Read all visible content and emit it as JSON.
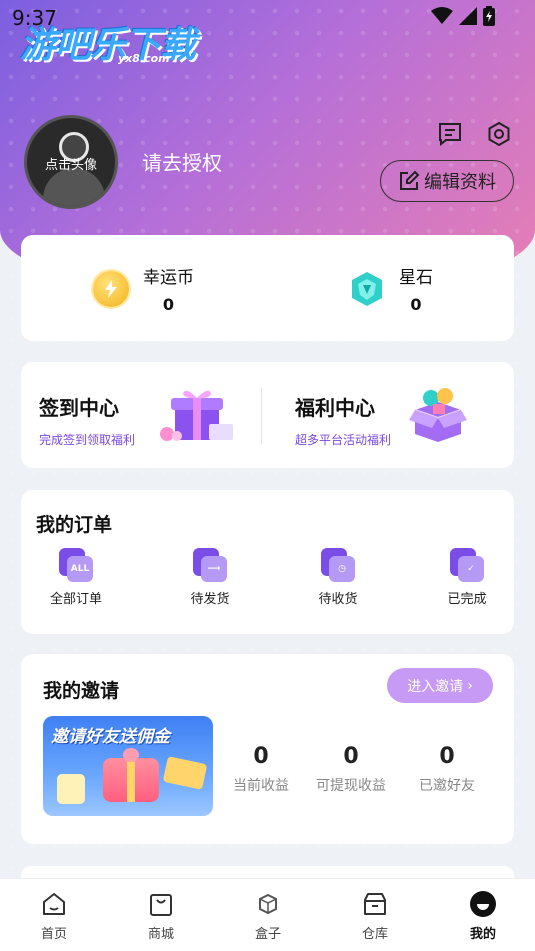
{
  "status": {
    "time": "9:37"
  },
  "watermark": {
    "text": "游吧乐下载",
    "url": "yx8.com"
  },
  "profile": {
    "avatar_label": "点击头像",
    "username": "请去授权",
    "edit_label": "编辑资料"
  },
  "currencies": [
    {
      "name": "幸运币",
      "value": "0",
      "icon": "lightning-coin-icon"
    },
    {
      "name": "星石",
      "value": "0",
      "icon": "star-stone-icon"
    }
  ],
  "centers": [
    {
      "title": "签到中心",
      "subtitle": "完成签到领取福利",
      "icon": "gift-box-icon"
    },
    {
      "title": "福利中心",
      "subtitle": "超多平台活动福利",
      "icon": "welfare-box-icon"
    }
  ],
  "orders": {
    "title": "我的订单",
    "items": [
      {
        "label": "全部订单",
        "badge": "ALL"
      },
      {
        "label": "待发货",
        "badge": ""
      },
      {
        "label": "待收货",
        "badge": ""
      },
      {
        "label": "已完成",
        "badge": ""
      }
    ]
  },
  "invite": {
    "title": "我的邀请",
    "button": "进入邀请",
    "banner_text": "邀请好友送佣金",
    "stats": [
      {
        "value": "0",
        "label": "当前收益"
      },
      {
        "value": "0",
        "label": "可提现收益"
      },
      {
        "value": "0",
        "label": "已邀好友"
      }
    ]
  },
  "tabs": [
    {
      "label": "首页",
      "icon": "home-icon"
    },
    {
      "label": "商城",
      "icon": "shop-bag-icon"
    },
    {
      "label": "盒子",
      "icon": "box-icon"
    },
    {
      "label": "仓库",
      "icon": "warehouse-icon"
    },
    {
      "label": "我的",
      "icon": "profile-dot-icon",
      "active": true
    }
  ],
  "colors": {
    "accent": "#7a48e0",
    "hero_start": "#7b5fe0",
    "hero_end": "#e97fb3",
    "invite_button": "#c79af5"
  }
}
